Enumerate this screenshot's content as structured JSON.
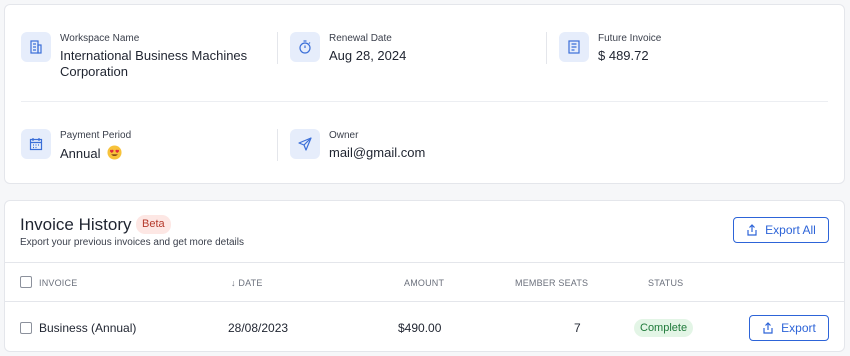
{
  "summary": {
    "workspace": {
      "label": "Workspace Name",
      "value_line1": "International Business Machines",
      "value_line2": "Corporation",
      "icon": "building-icon"
    },
    "renewal": {
      "label": "Renewal Date",
      "value": "Aug 28, 2024",
      "icon": "stopwatch-icon"
    },
    "future_invoice": {
      "label": "Future Invoice",
      "value": "$ 489.72",
      "icon": "receipt-icon"
    },
    "payment_period": {
      "label": "Payment Period",
      "value": "Annual",
      "icon": "calendar-icon",
      "emoji": "heart-eyes-emoji"
    },
    "owner": {
      "label": "Owner",
      "value": "mail@gmail.com",
      "icon": "paper-plane-icon"
    }
  },
  "history": {
    "title": "Invoice History",
    "badge": "Beta",
    "subtitle": "Export your previous invoices and get more details",
    "export_all_label": "Export All",
    "columns": {
      "invoice": "INVOICE",
      "date": "DATE",
      "amount": "AMOUNT",
      "seats": "MEMBER SEATS",
      "status": "STATUS"
    },
    "rows": [
      {
        "invoice": "Business (Annual)",
        "date": "28/08/2023",
        "amount": "$490.00",
        "seats": "7",
        "status": "Complete",
        "export_label": "Export"
      }
    ]
  },
  "colors": {
    "accent": "#2d64d8",
    "icon_bg": "#e6edfb",
    "beta_bg": "#fde7e4",
    "beta_text": "#b53a2c",
    "status_bg": "#e3f5e6",
    "status_text": "#1f7a3a"
  }
}
